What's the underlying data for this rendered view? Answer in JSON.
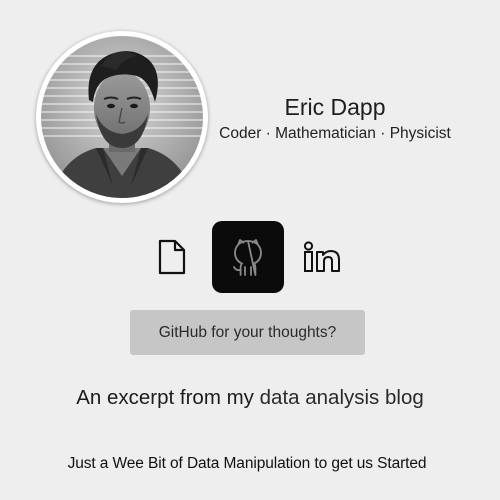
{
  "profile": {
    "name": "Eric Dapp",
    "tagline": "Coder · Mathematician · Physicist",
    "avatar_icon": "profile-photo"
  },
  "social": {
    "items": [
      {
        "icon": "document-icon",
        "active": false
      },
      {
        "icon": "github-icon",
        "active": true,
        "active_bg": "#0b0b0b"
      },
      {
        "icon": "linkedin-icon",
        "active": false
      }
    ]
  },
  "button": {
    "label": "GitHub for your thoughts?",
    "bg": "#c6c6c6"
  },
  "excerpt": {
    "prefix": "An excerpt from my ",
    "link_text": "data analysis blog"
  },
  "article": {
    "title": "Just a Wee Bit of Data Manipulation to get us Started"
  },
  "colors": {
    "background": "#eeeeee",
    "text": "#1f1f1f"
  }
}
